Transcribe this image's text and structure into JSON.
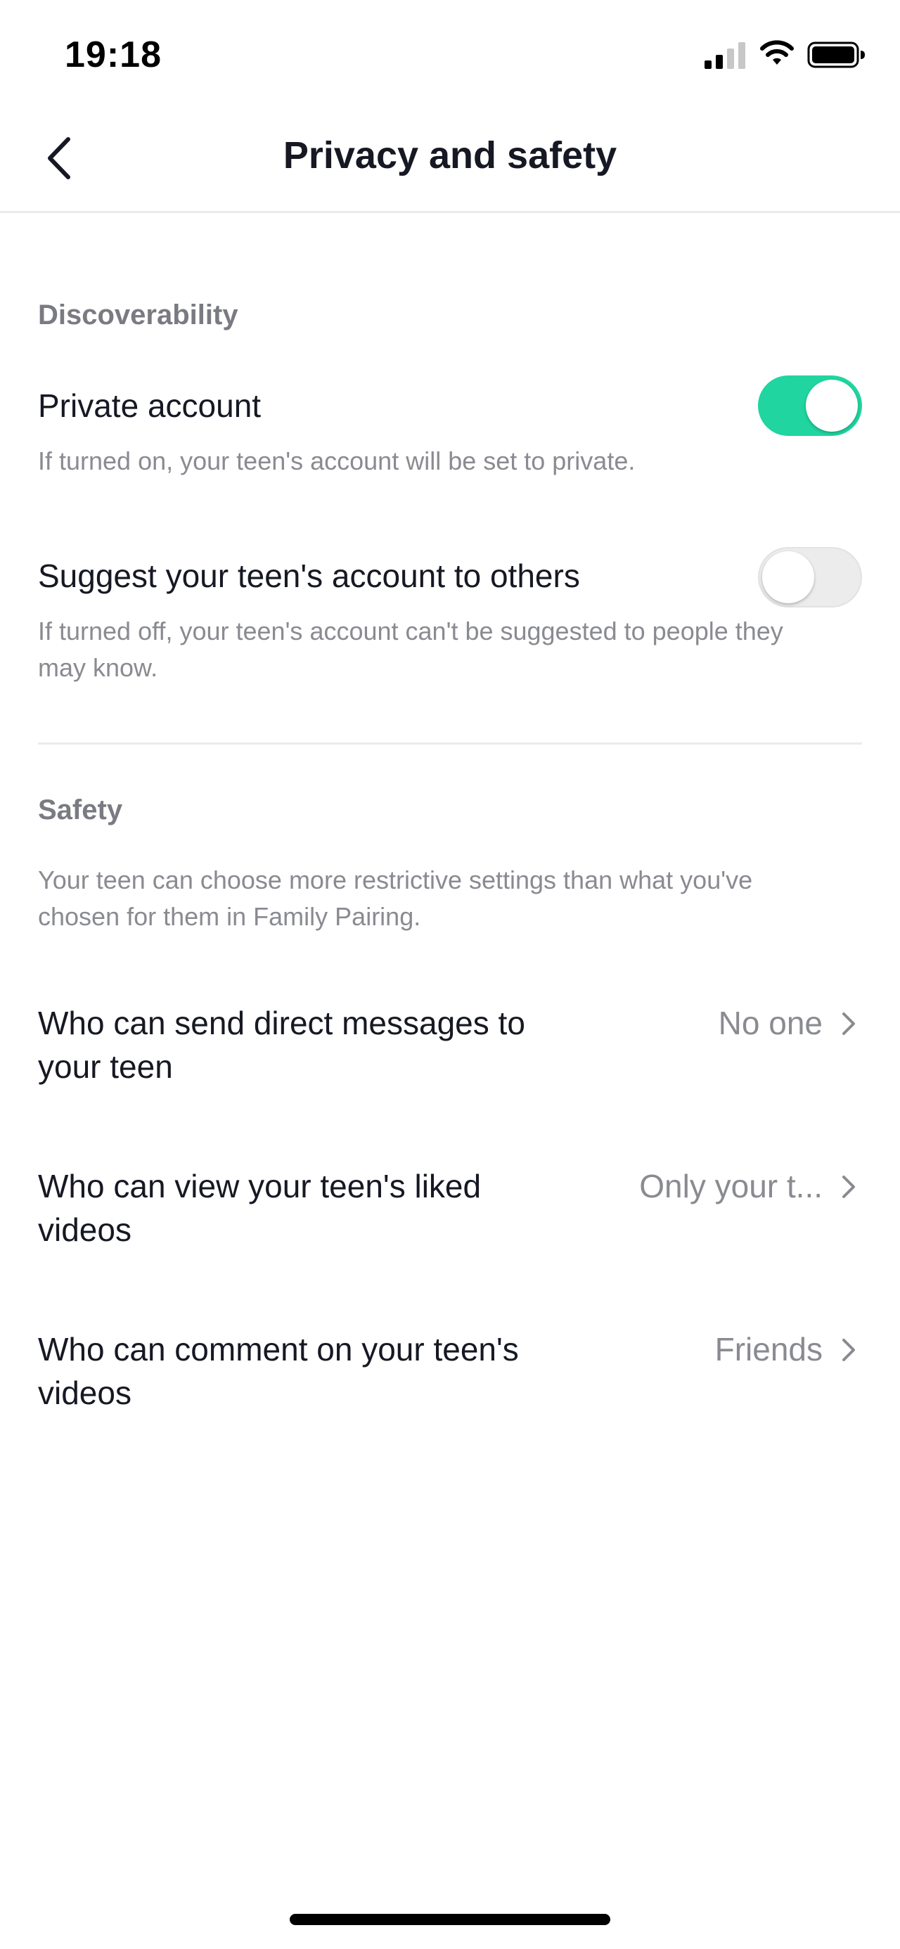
{
  "status_bar": {
    "time": "19:18"
  },
  "nav": {
    "title": "Privacy and safety"
  },
  "discoverability": {
    "header": "Discoverability",
    "private_account": {
      "title": "Private account",
      "description": "If turned on, your teen's account will be set to private.",
      "enabled": true
    },
    "suggest_account": {
      "title": "Suggest your teen's account to others",
      "description": "If turned off, your teen's account can't be suggested to people they may know.",
      "enabled": false
    }
  },
  "safety": {
    "header": "Safety",
    "description": "Your teen can choose more restrictive settings than what you've chosen for them in Family Pairing.",
    "rows": [
      {
        "label": "Who can send direct messages to your teen",
        "value": "No one"
      },
      {
        "label": "Who can view your teen's liked videos",
        "value": "Only your t..."
      },
      {
        "label": "Who can comment on your teen's videos",
        "value": "Friends"
      }
    ]
  },
  "colors": {
    "toggle_on": "#20d5a0",
    "toggle_off": "#ececec",
    "text_primary": "#161823",
    "text_secondary": "#8a8b91"
  },
  "icons": {
    "back": "chevron-left-icon",
    "row_arrow": "chevron-right-icon",
    "signal": "cellular-signal-icon",
    "wifi": "wifi-icon",
    "battery": "battery-icon"
  }
}
